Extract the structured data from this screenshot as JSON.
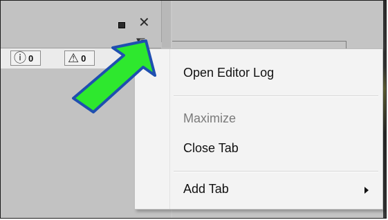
{
  "dock": {
    "icons": {
      "maximize": "maximize-icon",
      "close": "close-icon",
      "menu": "tab-menu-icon"
    },
    "close_glyph": "✕",
    "menu_glyph": "▾≡"
  },
  "counters": [
    {
      "icon": "info-icon",
      "glyph": "ⓘ",
      "value": "0"
    },
    {
      "icon": "warning-icon",
      "glyph": "⚠",
      "value": "0"
    }
  ],
  "context_menu": {
    "items": [
      {
        "label": "Open Editor Log",
        "enabled": true,
        "submenu": false
      },
      {
        "label": "Maximize",
        "enabled": false,
        "submenu": false
      },
      {
        "label": "Close Tab",
        "enabled": true,
        "submenu": false
      },
      {
        "label": "Add Tab",
        "enabled": true,
        "submenu": true
      }
    ]
  },
  "annotation": {
    "arrow_fill": "#2ee82e",
    "arrow_stroke": "#1f4fb0"
  }
}
